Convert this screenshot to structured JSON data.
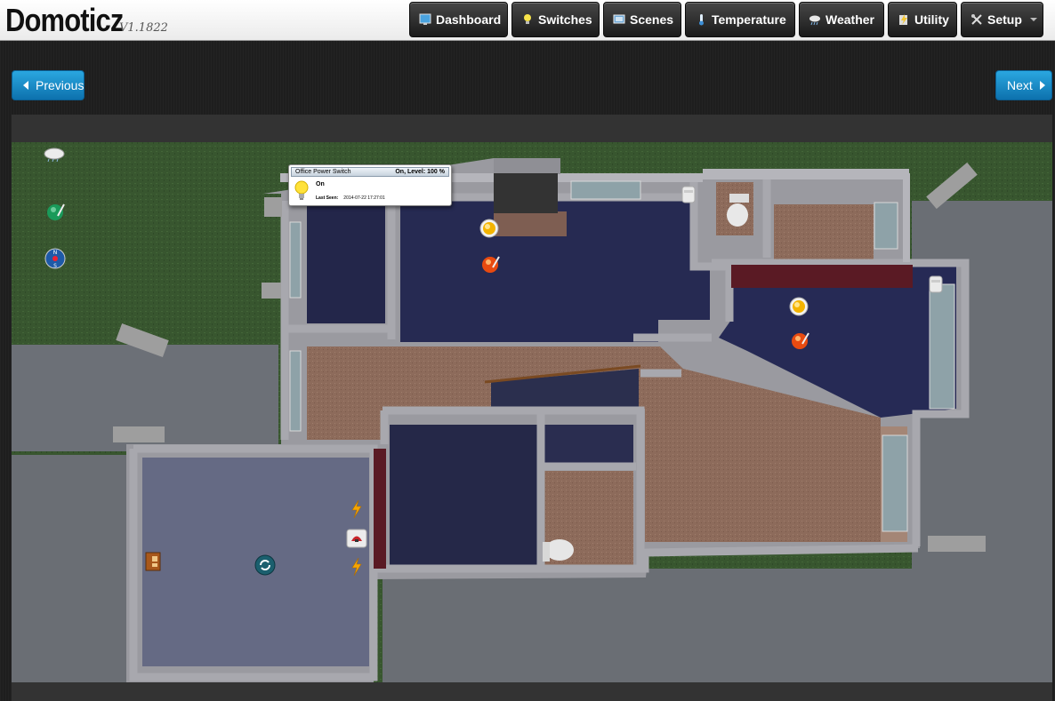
{
  "app": {
    "name": "Domoticz",
    "version": "V1.1822"
  },
  "nav": [
    {
      "label": "Dashboard",
      "icon": "dashboard-icon"
    },
    {
      "label": "Switches",
      "icon": "lightbulb-icon"
    },
    {
      "label": "Scenes",
      "icon": "scenes-icon"
    },
    {
      "label": "Temperature",
      "icon": "thermometer-icon"
    },
    {
      "label": "Weather",
      "icon": "weather-icon"
    },
    {
      "label": "Utility",
      "icon": "utility-icon"
    },
    {
      "label": "Setup",
      "icon": "setup-icon"
    }
  ],
  "pager": {
    "previous": "Previous",
    "next": "Next"
  },
  "tooltip": {
    "device_name": "Office Power Switch",
    "state": "On, Level: 100 %",
    "status": "On",
    "last_seen_label": "Last Seen:",
    "last_seen_value": "2014-07-22 17:27:01"
  },
  "floorplan_devices": [
    "weather-icon",
    "temperature-sensor-icon",
    "wind-compass-icon",
    "light-bulb-icon",
    "temperature-sensor-icon",
    "door-sensor-icon",
    "light-bulb-icon",
    "temperature-sensor-icon",
    "door-sensor-icon",
    "power-icon",
    "security-camera-icon",
    "power-icon",
    "door-lock-icon",
    "refresh-icon"
  ],
  "colors": {
    "accent_blue": "#1a8cc9",
    "nav_dark": "#2c2c2c",
    "grass": "#3a5a34",
    "room_floor_dark": "#222544",
    "room_floor_wood": "#8c6a5a",
    "wall": "#8a8a90"
  }
}
